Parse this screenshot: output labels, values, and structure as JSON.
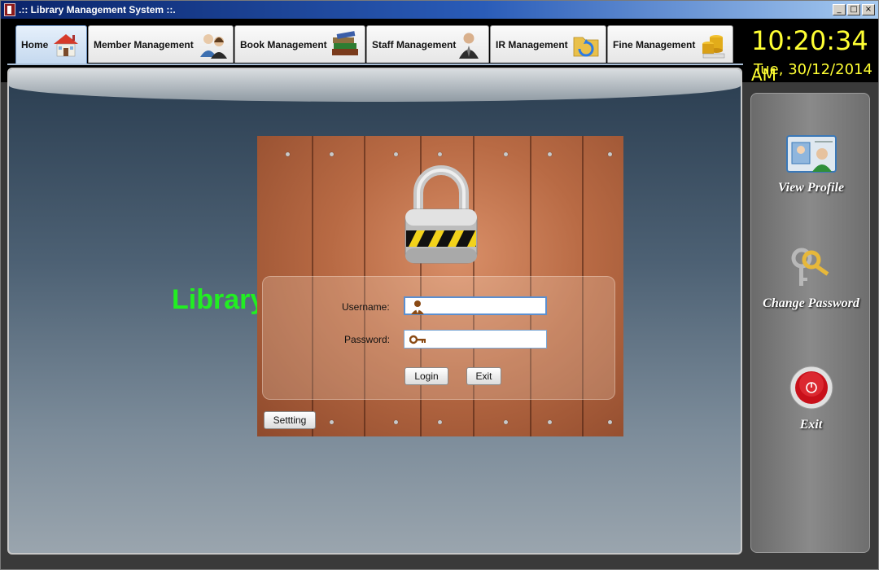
{
  "window": {
    "title": ".:: Library Management System ::.",
    "controls": [
      "_",
      "□",
      "×"
    ]
  },
  "tabs": [
    {
      "label": "Home",
      "icon": "house-icon",
      "active": true
    },
    {
      "label": "Member Management",
      "icon": "people-icon",
      "active": false
    },
    {
      "label": "Book Management",
      "icon": "books-icon",
      "active": false
    },
    {
      "label": "Staff Management",
      "icon": "staff-person-icon",
      "active": false
    },
    {
      "label": "IR Management",
      "icon": "folder-refresh-icon",
      "active": false
    },
    {
      "label": "Fine Management",
      "icon": "coins-icon",
      "active": false
    }
  ],
  "clock": {
    "time": "10:20:34",
    "ampm": "AM",
    "date": "Tue, 30/12/2014",
    "color": "#ffff33"
  },
  "main": {
    "title_text": "Library"
  },
  "login": {
    "username_label": "Username:",
    "password_label": "Password:",
    "username_value": "",
    "password_value": "",
    "username_icon": "user-icon",
    "password_icon": "key-icon",
    "login_button": "Login",
    "exit_button": "Exit",
    "setting_button": "Settting"
  },
  "side_menu": [
    {
      "label": "View Profile",
      "icon": "profile-card-icon"
    },
    {
      "label": "Change Password",
      "icon": "keys-icon"
    },
    {
      "label": "Exit",
      "icon": "power-button-icon"
    }
  ],
  "colors": {
    "title_text_color": "#22ee22",
    "active_tab": "#c5d9ef"
  }
}
